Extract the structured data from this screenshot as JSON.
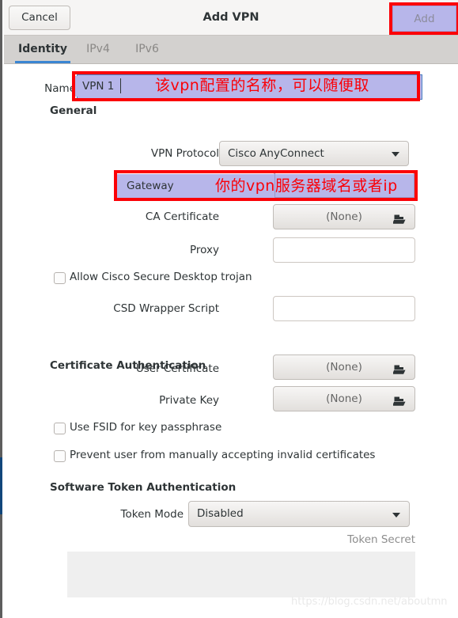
{
  "window": {
    "title": "Add VPN",
    "cancel_label": "Cancel",
    "add_label": "Add"
  },
  "tabs": [
    {
      "label": "Identity",
      "active": true
    },
    {
      "label": "IPv4",
      "active": false
    },
    {
      "label": "IPv6",
      "active": false
    }
  ],
  "form": {
    "name": {
      "label": "Name",
      "value": "VPN 1"
    },
    "general": {
      "heading": "General",
      "vpn_protocol": {
        "label": "VPN Protocol",
        "value": "Cisco AnyConnect"
      },
      "gateway": {
        "label": "Gateway",
        "value": ""
      },
      "ca_certificate": {
        "label": "CA Certificate",
        "value": "(None)",
        "icon": "file-open-icon"
      },
      "proxy": {
        "label": "Proxy",
        "value": ""
      },
      "allow_csd": {
        "label": "Allow Cisco Secure Desktop trojan",
        "checked": false
      },
      "csd_wrapper_script": {
        "label": "CSD Wrapper Script",
        "value": ""
      }
    },
    "certificate_authentication": {
      "heading": "Certificate Authentication",
      "user_certificate": {
        "label": "User Certificate",
        "value": "(None)",
        "icon": "file-open-icon"
      },
      "private_key": {
        "label": "Private Key",
        "value": "(None)",
        "icon": "file-open-icon"
      },
      "use_fsid": {
        "label": "Use FSID for key passphrase",
        "checked": false
      },
      "prevent_invalid_certs": {
        "label": "Prevent user from manually accepting invalid certificates",
        "checked": false
      }
    },
    "software_token_authentication": {
      "heading": "Software Token Authentication",
      "token_mode": {
        "label": "Token Mode",
        "value": "Disabled"
      },
      "token_secret": {
        "label": "Token Secret",
        "value": ""
      }
    }
  },
  "annotations": {
    "name_note": "该vpn配置的名称，可以随便取",
    "gateway_note": "你的vpn服务器域名或者ip",
    "highlight_color": "#fb0007",
    "fill_color": "#b7b6ea"
  },
  "watermark": "https://blog.csdn.net/aboutmn"
}
